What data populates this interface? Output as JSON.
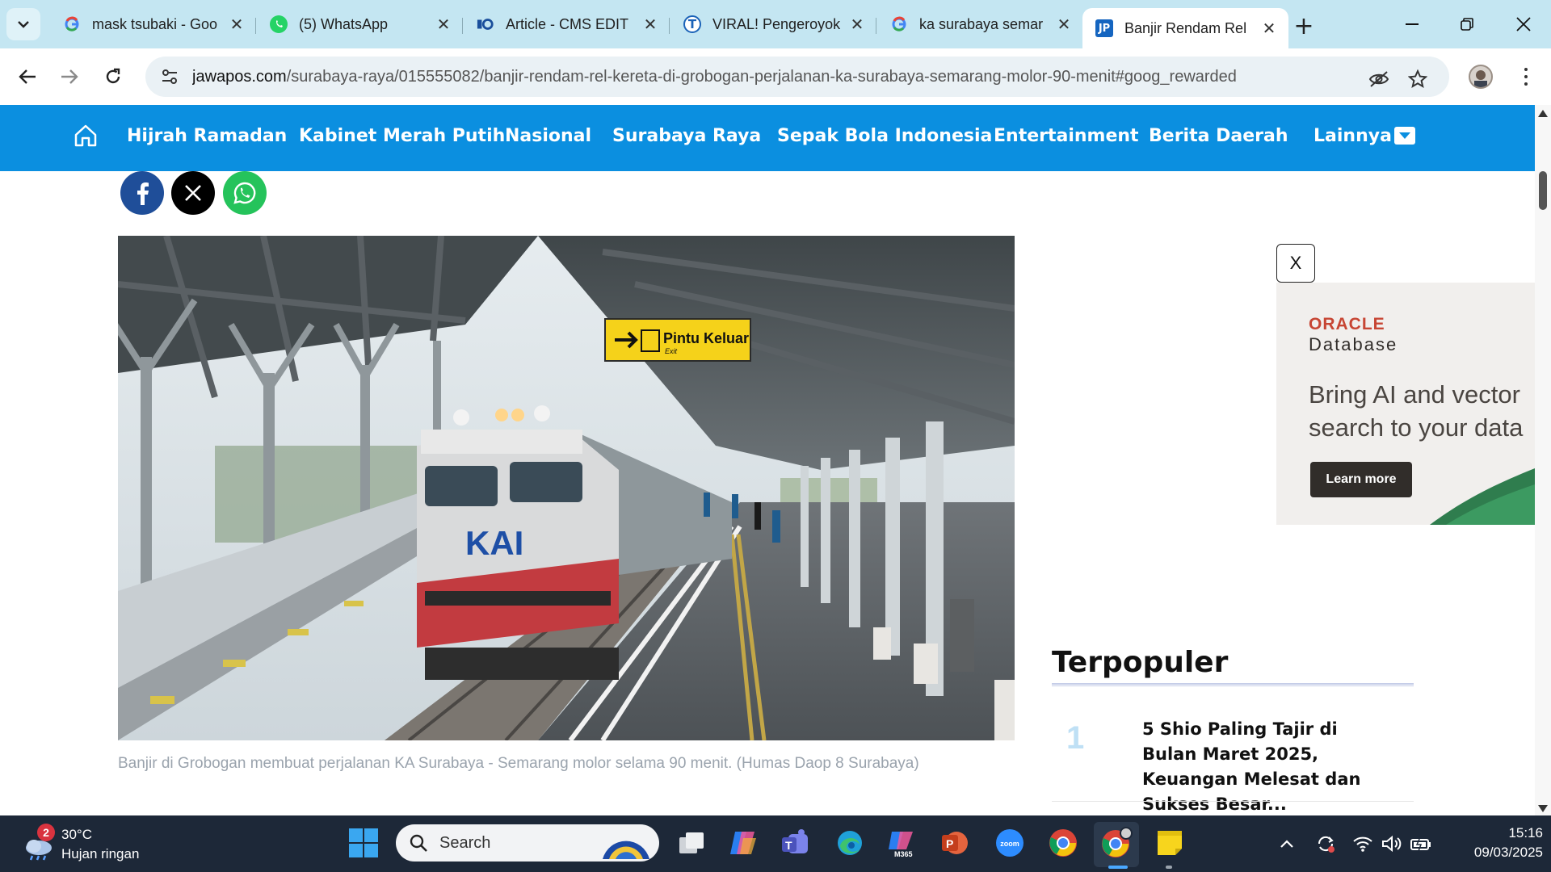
{
  "browser": {
    "tabs": [
      {
        "title": "mask tsubaki - Goo",
        "favicon": "google-icon"
      },
      {
        "title": "(5) WhatsApp",
        "favicon": "whatsapp-icon"
      },
      {
        "title": "Article - CMS EDIT",
        "favicon": "cms-icon"
      },
      {
        "title": "VIRAL! Pengeroyok",
        "favicon": "tribun-icon"
      },
      {
        "title": "ka surabaya semar",
        "favicon": "google-icon"
      },
      {
        "title": "Banjir Rendam Rel",
        "favicon": "jawapos-icon",
        "active": true
      }
    ],
    "url_host": "jawapos.com",
    "url_path": "/surabaya-raya/015555082/banjir-rendam-rel-kereta-di-grobogan-perjalanan-ka-surabaya-semarang-molor-90-menit#goog_rewarded"
  },
  "site_nav": {
    "items": [
      "Hijrah Ramadan",
      "Kabinet Merah Putih",
      "Nasional",
      "Surabaya Raya",
      "Sepak Bola Indonesia",
      "Entertainment",
      "Berita Daerah",
      "Lainnya"
    ],
    "color": "#0b8fe0"
  },
  "share": {
    "facebook_color": "#1f4e99",
    "x_color": "#000000",
    "whatsapp_color": "#25c35b"
  },
  "article": {
    "image_text": {
      "sign_main": "Pintu Keluar",
      "sign_sub": "Exit",
      "locomotive_logo": "KAI"
    },
    "caption": "Banjir di Grobogan membuat perjalanan KA Surabaya - Semarang molor selama 90 menit. (Humas Daop 8 Surabaya)"
  },
  "ad": {
    "close_label": "X",
    "brand_line1": "ORACLE",
    "brand_line2": "Database",
    "headline": "Bring AI and vector search to your data",
    "cta": "Learn more"
  },
  "popular": {
    "title": "Terpopuler",
    "items": [
      {
        "rank": "1",
        "text": "5 Shio Paling Tajir di Bulan Maret 2025, Keuangan Melesat dan Sukses Besar..."
      }
    ]
  },
  "taskbar": {
    "weather_badge": "2",
    "temperature": "30°C",
    "condition": "Hujan ringan",
    "search_label": "Search",
    "app_label_m365": "M365",
    "app_label_zoom": "zoom",
    "time": "15:16",
    "date": "09/03/2025"
  }
}
